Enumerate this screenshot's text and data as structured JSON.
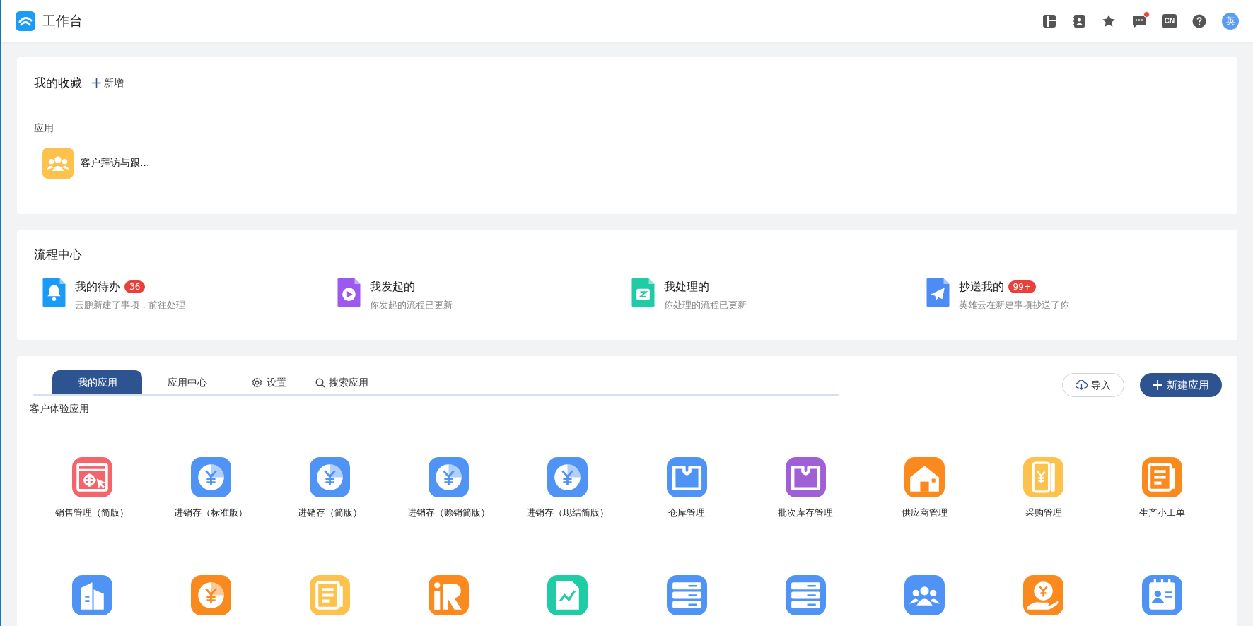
{
  "header": {
    "title": "工作台",
    "lang_badge": "CN",
    "avatar": "英",
    "has_unread": true
  },
  "favorites": {
    "title": "我的收藏",
    "add_label": "新增",
    "section": "应用",
    "items": [
      {
        "label": "客户拜访与跟...",
        "kind": "people",
        "color": "#fcc24c"
      }
    ]
  },
  "process_center": {
    "title": "流程中心",
    "items": [
      {
        "title": "我的待办",
        "badge": "36",
        "subtitle": "云鹏新建了事项，前往处理",
        "kind": "bell",
        "color": "#1a9bf5"
      },
      {
        "title": "我发起的",
        "subtitle": "你发起的流程已更新",
        "kind": "play",
        "color": "#9b59f0"
      },
      {
        "title": "我处理的",
        "subtitle": "你处理的流程已更新",
        "kind": "tray",
        "color": "#1fcca5"
      },
      {
        "title": "抄送我的",
        "badge": "99+",
        "subtitle": "英雄云在新建事项抄送了你",
        "kind": "plane",
        "color": "#4e8cf5"
      }
    ]
  },
  "apps": {
    "tabs": [
      {
        "label": "我的应用",
        "selected": true
      },
      {
        "label": "应用中心",
        "selected": false
      }
    ],
    "settings_label": "设置",
    "search_label": "搜索应用",
    "import_label": "导入",
    "new_label": "新建应用",
    "group": "客户体验应用",
    "items": [
      {
        "label": "销售管理（简版）",
        "kind": "target",
        "color": "#f5636b"
      },
      {
        "label": "进销存（标准版）",
        "kind": "yen",
        "color": "#4f94f4"
      },
      {
        "label": "进销存（简版）",
        "kind": "yen",
        "color": "#4f94f4"
      },
      {
        "label": "进销存（赊销简版）",
        "kind": "yen",
        "color": "#4f94f4"
      },
      {
        "label": "进销存（现结简版）",
        "kind": "yen",
        "color": "#4f94f4"
      },
      {
        "label": "仓库管理",
        "kind": "box",
        "color": "#4f94f4"
      },
      {
        "label": "批次库存管理",
        "kind": "box",
        "color": "#a05fd4"
      },
      {
        "label": "供应商管理",
        "kind": "house",
        "color": "#fb8a1e"
      },
      {
        "label": "采购管理",
        "kind": "ledger",
        "color": "#fcc24c"
      },
      {
        "label": "生产小工单",
        "kind": "doc",
        "color": "#fb8a1e"
      },
      {
        "kind": "building",
        "color": "#4f94f4"
      },
      {
        "kind": "yen",
        "color": "#fb8a1e"
      },
      {
        "kind": "doc",
        "color": "#fcc24c"
      },
      {
        "kind": "hr",
        "color": "#fb8a1e"
      },
      {
        "kind": "wave",
        "color": "#1fcca5"
      },
      {
        "kind": "server",
        "color": "#4f94f4"
      },
      {
        "kind": "server",
        "color": "#4f94f4"
      },
      {
        "kind": "people",
        "color": "#4f94f4"
      },
      {
        "kind": "hand",
        "color": "#fb8a1e"
      },
      {
        "kind": "card",
        "color": "#4f94f4"
      }
    ]
  }
}
